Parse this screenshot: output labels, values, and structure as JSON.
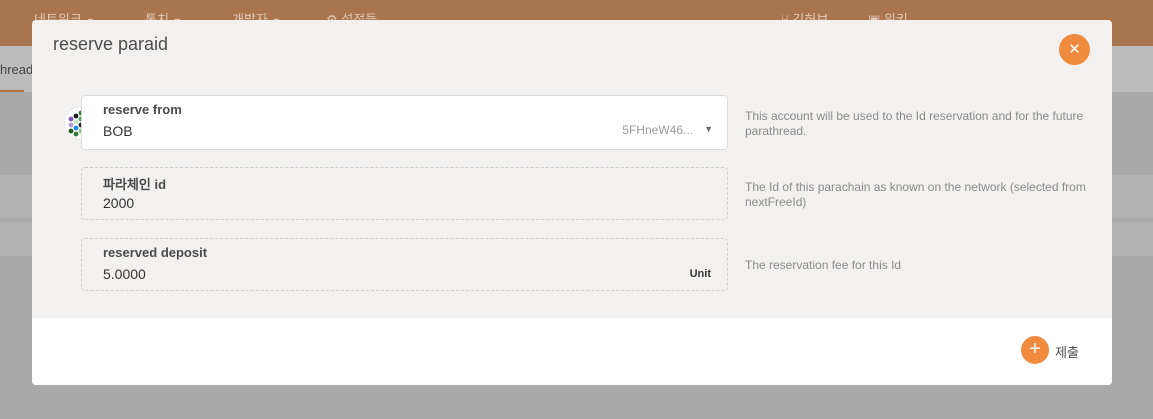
{
  "background": {
    "nav": [
      {
        "label": "네트워크",
        "caret": "▼"
      },
      {
        "label": "통치",
        "caret": "▼"
      },
      {
        "label": "개발자",
        "caret": "▼"
      },
      {
        "label": "설정들",
        "caret": "",
        "icon": "gear-icon"
      },
      {
        "label": "깃허브",
        "caret": "",
        "icon": "branch-icon"
      },
      {
        "label": "위키",
        "caret": "",
        "icon": "book-icon"
      }
    ],
    "tab_fragment": "hread"
  },
  "modal": {
    "title": "reserve paraid",
    "close_icon": "✕",
    "fields": {
      "reserve_from": {
        "label": "reserve from",
        "value": "BOB",
        "address": "5FHneW46...",
        "caret": "▼",
        "help": "This account will be used to the Id reservation and for the future parathread."
      },
      "parachain_id": {
        "label": "파라체인 id",
        "value": "2000",
        "help": "The Id of this parachain as known on the network (selected from nextFreeId)"
      },
      "deposit": {
        "label": "reserved deposit",
        "value": "5.0000",
        "unit": "Unit",
        "help": "The reservation fee for this Id"
      }
    },
    "submit": {
      "icon": "+",
      "label": "제출"
    }
  },
  "colors": {
    "accent": "#f08a3c",
    "topbar": "#a9754e",
    "overlay": "#a9a9a9"
  }
}
